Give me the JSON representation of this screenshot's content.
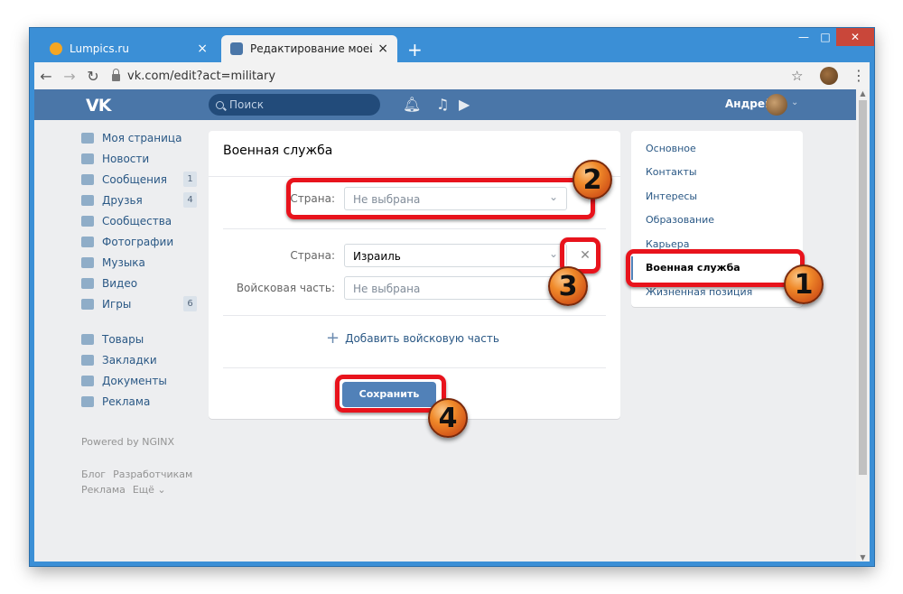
{
  "browser": {
    "tabs": [
      {
        "title": "Lumpics.ru",
        "close": "×"
      },
      {
        "title": "Редактирование моей страницы",
        "close": "×"
      }
    ],
    "new_tab": "+",
    "url": "vk.com/edit?act=military",
    "win_min": "—",
    "win_max": "□",
    "win_close": "✕"
  },
  "vk_header": {
    "logo": "VK",
    "search_placeholder": "Поиск",
    "user_name": "Андрей"
  },
  "left_menu": [
    {
      "label": "Моя страница",
      "count": ""
    },
    {
      "label": "Новости",
      "count": ""
    },
    {
      "label": "Сообщения",
      "count": "1"
    },
    {
      "label": "Друзья",
      "count": "4"
    },
    {
      "label": "Сообщества",
      "count": ""
    },
    {
      "label": "Фотографии",
      "count": ""
    },
    {
      "label": "Музыка",
      "count": ""
    },
    {
      "label": "Видео",
      "count": ""
    },
    {
      "label": "Игры",
      "count": "6"
    }
  ],
  "left_menu_2": [
    {
      "label": "Товары"
    },
    {
      "label": "Закладки"
    },
    {
      "label": "Документы"
    },
    {
      "label": "Реклама"
    }
  ],
  "powered": "Powered by NGINX",
  "footer": {
    "blog": "Блог",
    "devs": "Разработчикам",
    "ads": "Реклама",
    "more": "Ещё ⌄"
  },
  "form": {
    "title": "Военная служба",
    "row1_label": "Страна:",
    "row1_value": "Не выбрана",
    "row2_label": "Страна:",
    "row2_value": "Израиль",
    "row3_label": "Войсковая часть:",
    "row3_value": "Не выбрана",
    "add_unit": "Добавить войсковую часть",
    "save": "Сохранить"
  },
  "right_nav": [
    {
      "label": "Основное",
      "active": false
    },
    {
      "label": "Контакты",
      "active": false
    },
    {
      "label": "Интересы",
      "active": false
    },
    {
      "label": "Образование",
      "active": false
    },
    {
      "label": "Карьера",
      "active": false
    },
    {
      "label": "Военная служба",
      "active": true
    },
    {
      "label": "Жизненная позиция",
      "active": false
    }
  ],
  "callouts": [
    "1",
    "2",
    "3",
    "4"
  ],
  "colors": {
    "vk_blue": "#4a76a8",
    "highlight_red": "#e8131c",
    "badge_orange": "#f08a2a"
  }
}
